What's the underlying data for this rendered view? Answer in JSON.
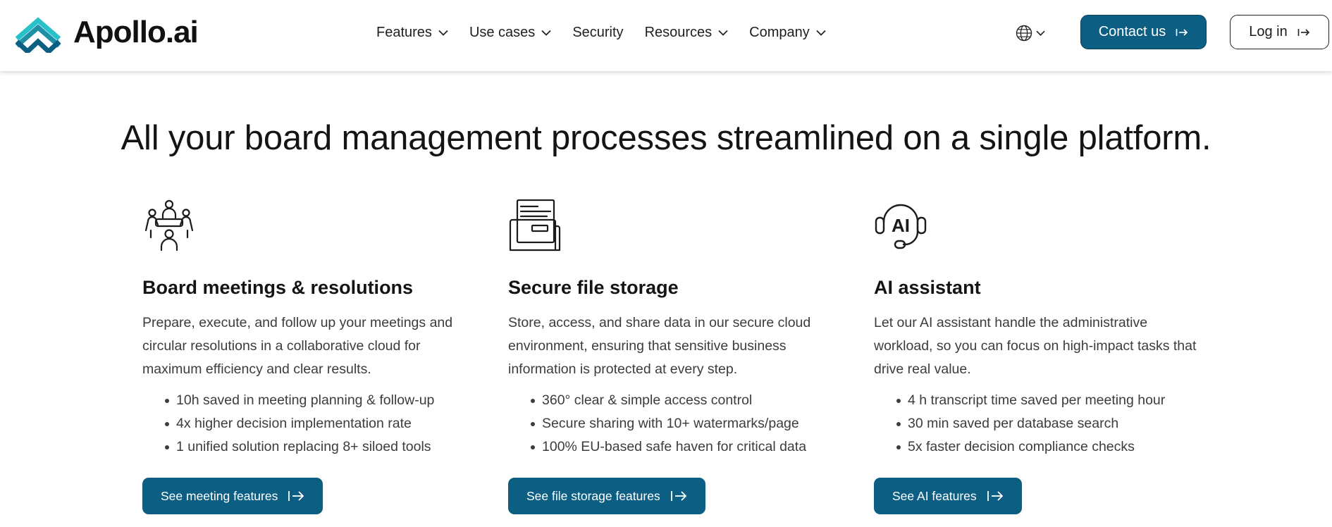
{
  "brand": {
    "name": "Apollo.ai",
    "logo_colors": [
      "#29c1c9",
      "#1f8fa6",
      "#0d5e83"
    ]
  },
  "nav": {
    "items": [
      {
        "label": "Features",
        "dropdown": true
      },
      {
        "label": "Use cases",
        "dropdown": true
      },
      {
        "label": "Security",
        "dropdown": false
      },
      {
        "label": "Resources",
        "dropdown": true
      },
      {
        "label": "Company",
        "dropdown": true
      }
    ],
    "language_icon": "globe-icon",
    "contact_label": "Contact us",
    "login_label": "Log in"
  },
  "colors": {
    "primary": "#0d5e83",
    "text": "#141414",
    "muted_text": "#3c3c3c"
  },
  "headline": "All your board management processes streamlined on a single platform.",
  "cards": [
    {
      "icon": "meeting-people-icon",
      "title": "Board meetings & resolutions",
      "description": "Prepare, execute, and follow up your meetings and circular resolutions in a collaborative cloud for maximum efficiency and clear results.",
      "bullets": [
        "10h saved in meeting planning & follow-up",
        "4x higher decision implementation rate",
        "1 unified solution replacing 8+ siloed tools"
      ],
      "button_label": "See meeting features"
    },
    {
      "icon": "file-folder-icon",
      "title": "Secure file storage",
      "description": "Store, access, and share data in our secure cloud environment, ensuring that sensitive business information is protected at every step.",
      "bullets": [
        "360° clear & simple access control",
        "Secure sharing with 10+ watermarks/page",
        "100% EU-based safe haven for critical data"
      ],
      "button_label": "See file storage features"
    },
    {
      "icon": "ai-headset-icon",
      "title": "AI assistant",
      "description": "Let our AI assistant handle the administrative workload, so you can focus on high-impact tasks that drive real value.",
      "bullets": [
        "4 h transcript time saved per meeting hour",
        "30 min saved per database search",
        "5x faster decision compliance checks"
      ],
      "button_label": "See AI features",
      "icon_text": "AI"
    }
  ]
}
